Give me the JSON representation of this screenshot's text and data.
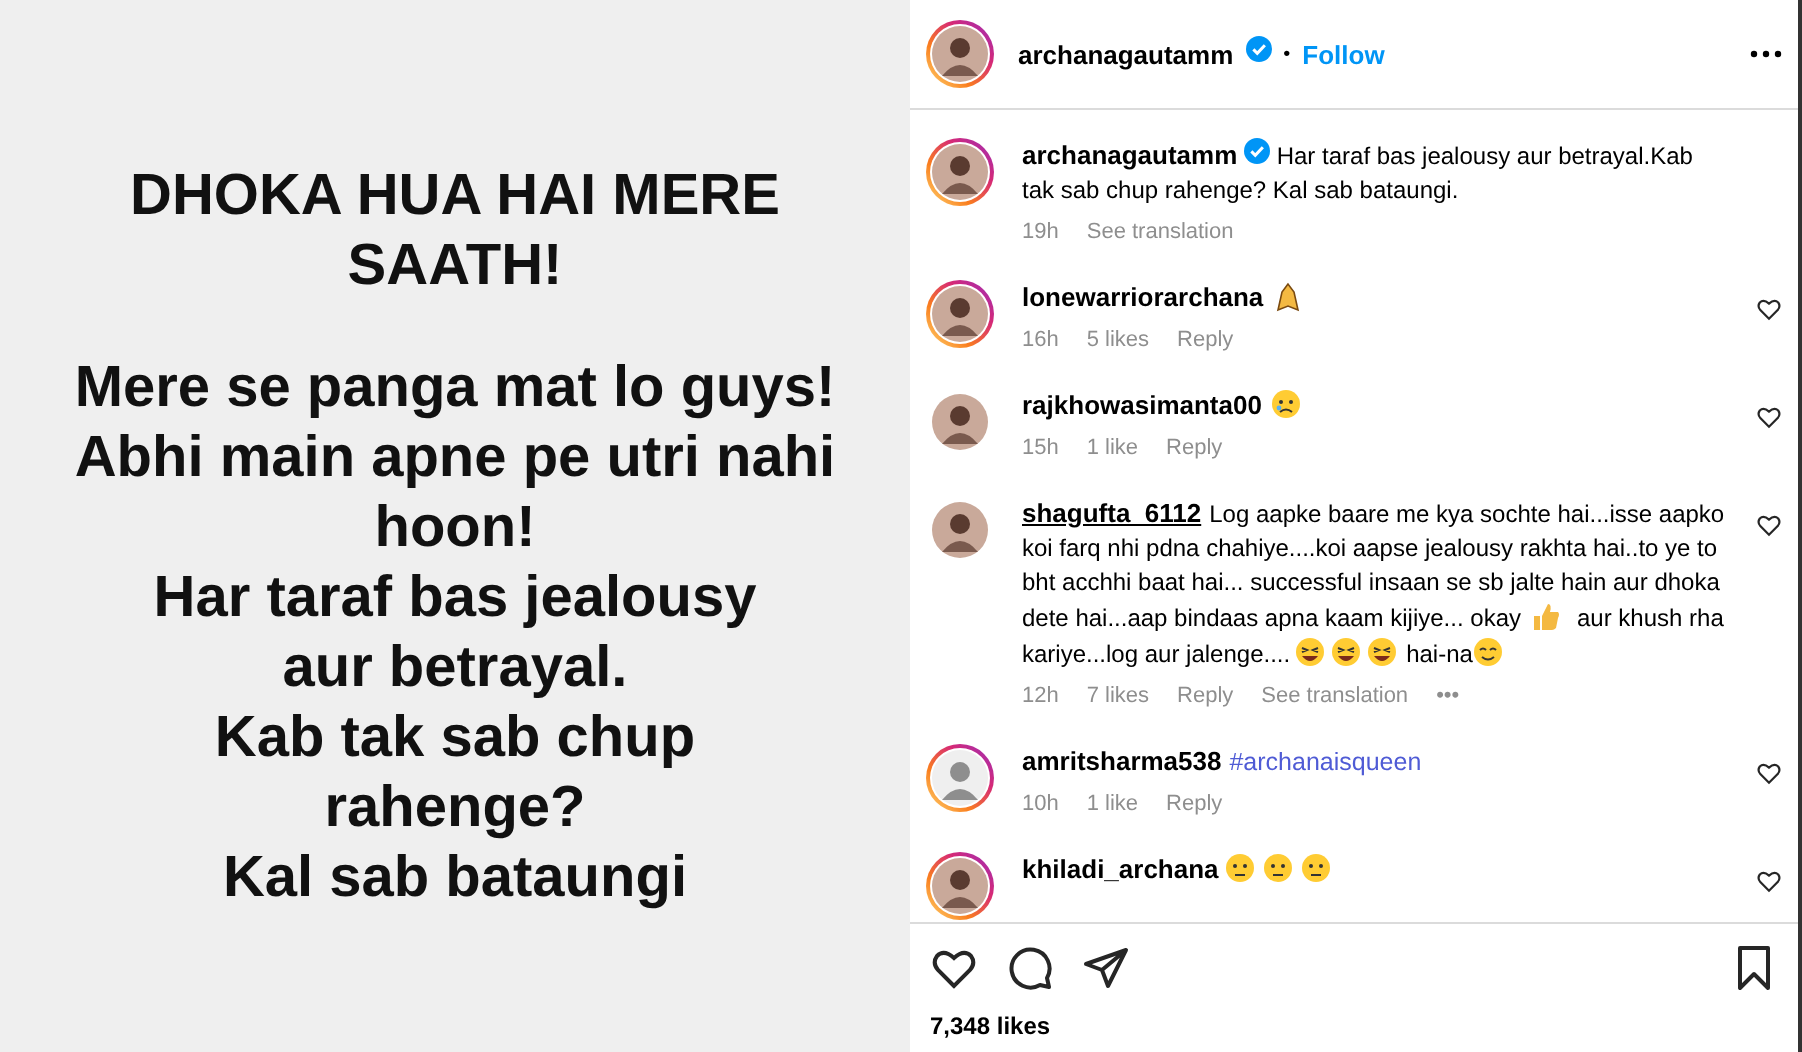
{
  "post_image": {
    "paragraphs": [
      [
        "DHOKA HUA HAI MERE",
        "SAATH!"
      ],
      [
        "Mere se panga mat lo guys!",
        "Abhi main apne pe utri nahi",
        "hoon!",
        "Har taraf bas jealousy",
        "aur betrayal.",
        "Kab tak sab chup",
        "rahenge?",
        "Kal sab bataungi"
      ]
    ]
  },
  "header": {
    "username": "archanagautamm",
    "verified": true,
    "separator": "•",
    "follow": "Follow",
    "story_ring": true
  },
  "caption": {
    "username": "archanagautamm",
    "verified": true,
    "text": "Har taraf bas jealousy aur betrayal.Kab tak sab chup rahenge? Kal sab bataungi.",
    "time": "19h",
    "translate": "See translation",
    "story_ring": true
  },
  "comments": [
    {
      "username": "lonewarriorarchana",
      "story_ring": true,
      "underlined": false,
      "default_avatar": false,
      "body": [
        {
          "kind": "praying"
        }
      ],
      "time": "16h",
      "likes": "5 likes",
      "reply": "Reply"
    },
    {
      "username": "rajkhowasimanta00",
      "story_ring": false,
      "underlined": false,
      "default_avatar": false,
      "body": [
        {
          "kind": "sad"
        }
      ],
      "time": "15h",
      "likes": "1 like",
      "reply": "Reply"
    },
    {
      "username": "shagufta_6112",
      "story_ring": false,
      "underlined": true,
      "default_avatar": false,
      "body": [
        {
          "kind": "text",
          "text": "Log aapke baare me kya sochte hai...isse aapko koi farq nhi pdna chahiye....koi aapse jealousy rakhta hai..to ye to bht acchhi baat hai... successful insaan se sb jalte hain aur dhoka dete hai...aap bindaas apna kaam kijiye... okay"
        },
        {
          "kind": "thumbs-up"
        },
        {
          "kind": "text",
          "text": "aur khush rha kariye...log aur jalenge...."
        },
        {
          "kind": "laughing"
        },
        {
          "kind": "laughing"
        },
        {
          "kind": "laughing"
        },
        {
          "kind": "text",
          "text": "hai-na"
        },
        {
          "kind": "smiling"
        }
      ],
      "time": "12h",
      "likes": "7 likes",
      "reply": "Reply",
      "translate": "See translation",
      "more": "•••"
    },
    {
      "username": "amritsharma538",
      "story_ring": true,
      "underlined": false,
      "default_avatar": true,
      "body": [
        {
          "kind": "hashtag",
          "text": "#archanaisqueen"
        }
      ],
      "time": "10h",
      "likes": "1 like",
      "reply": "Reply"
    },
    {
      "username": "khiladi_archana",
      "story_ring": true,
      "underlined": false,
      "default_avatar": false,
      "body": [
        {
          "kind": "worried"
        },
        {
          "kind": "worried"
        },
        {
          "kind": "worried"
        }
      ]
    }
  ],
  "likes": "7,348 likes"
}
